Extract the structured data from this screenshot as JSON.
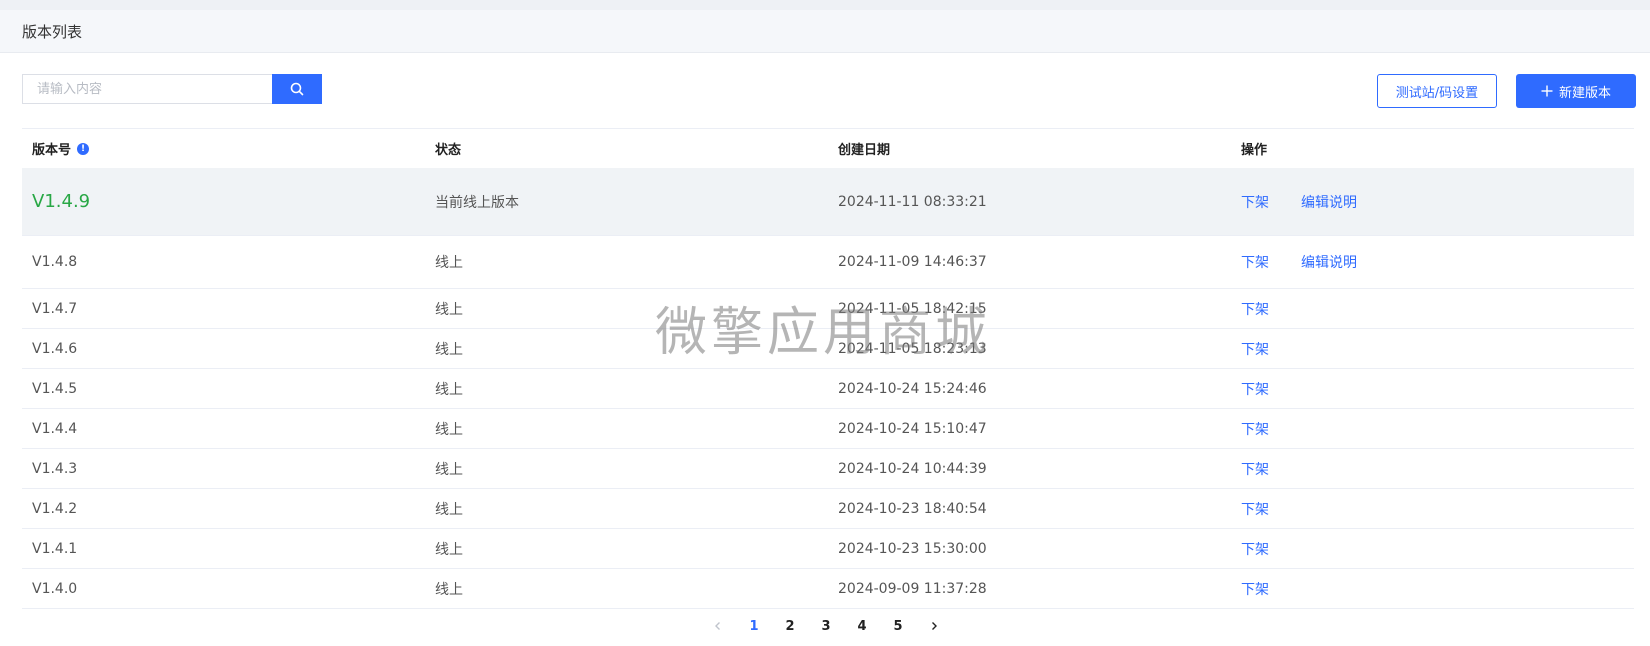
{
  "header": {
    "title": "版本列表"
  },
  "search": {
    "placeholder": "请输入内容",
    "value": ""
  },
  "toolbar": {
    "test_settings_label": "测试站/码设置",
    "new_version_label": "新建版本"
  },
  "table": {
    "columns": {
      "version": "版本号",
      "status": "状态",
      "created": "创建日期",
      "actions": "操作"
    },
    "rows": [
      {
        "version": "V1.4.9",
        "status": "当前线上版本",
        "created": "2024-11-11 08:33:21",
        "action1": "下架",
        "action2": "编辑说明"
      },
      {
        "version": "V1.4.8",
        "status": "线上",
        "created": "2024-11-09 14:46:37",
        "action1": "下架",
        "action2": "编辑说明"
      },
      {
        "version": "V1.4.7",
        "status": "线上",
        "created": "2024-11-05 18:42:15",
        "action1": "下架"
      },
      {
        "version": "V1.4.6",
        "status": "线上",
        "created": "2024-11-05 18:23:13",
        "action1": "下架"
      },
      {
        "version": "V1.4.5",
        "status": "线上",
        "created": "2024-10-24 15:24:46",
        "action1": "下架"
      },
      {
        "version": "V1.4.4",
        "status": "线上",
        "created": "2024-10-24 15:10:47",
        "action1": "下架"
      },
      {
        "version": "V1.4.3",
        "status": "线上",
        "created": "2024-10-24 10:44:39",
        "action1": "下架"
      },
      {
        "version": "V1.4.2",
        "status": "线上",
        "created": "2024-10-23 18:40:54",
        "action1": "下架"
      },
      {
        "version": "V1.4.1",
        "status": "线上",
        "created": "2024-10-23 15:30:00",
        "action1": "下架"
      },
      {
        "version": "V1.4.0",
        "status": "线上",
        "created": "2024-09-09 11:37:28",
        "action1": "下架"
      }
    ]
  },
  "pagination": {
    "pages": [
      "1",
      "2",
      "3",
      "4",
      "5"
    ],
    "current": "1"
  },
  "watermark": {
    "text": "微擎应用商城"
  },
  "colors": {
    "primary": "#2f6bff",
    "current_version": "#28a745"
  }
}
